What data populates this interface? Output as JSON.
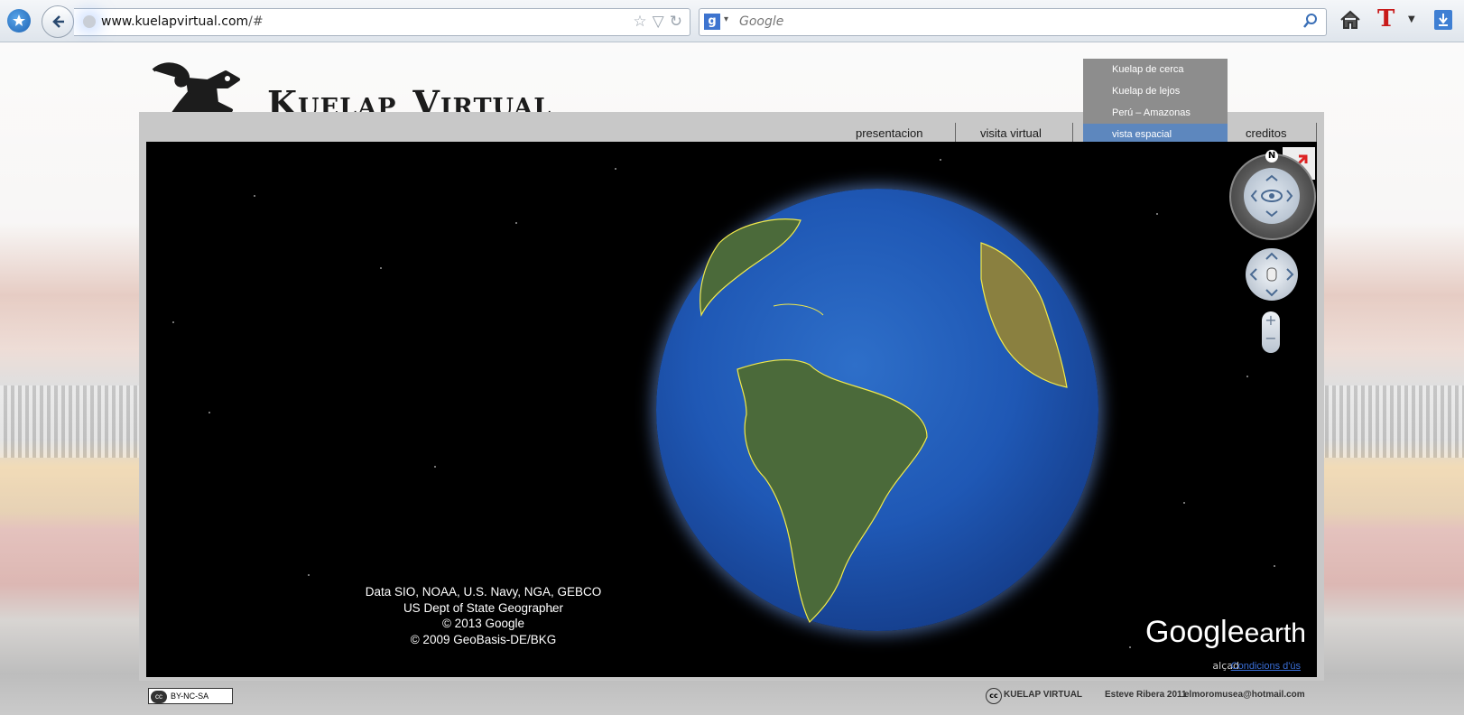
{
  "browser": {
    "url_host": "www.kuelapvirtual.com",
    "url_path": "/#",
    "search_placeholder": "Google"
  },
  "site": {
    "title_word1": "Kuelap",
    "title_word2": "Virtual"
  },
  "nav": {
    "items": [
      "presentacion",
      "visita virtual",
      "creditos"
    ]
  },
  "dropdown": {
    "items": [
      "Kuelap de cerca",
      "Kuelap de lejos",
      "Perú – Amazonas",
      "vista espacial"
    ],
    "active_index": 3
  },
  "earth": {
    "attribution": [
      "Data SIO, NOAA, U.S. Navy, NGA, GEBCO",
      "US Dept of State Geographer",
      "© 2013 Google",
      "© 2009 GeoBasis-DE/BKG"
    ],
    "brand_main": "Google",
    "brand_sub": "earth",
    "terms_prefix": "alçad",
    "terms_link": "Condicions d'ús",
    "compass_label": "N",
    "zoom_in": "+",
    "zoom_out": "−"
  },
  "footer": {
    "cc_license": "BY-NC-SA",
    "cc_mark": "cc",
    "site_name": "KUELAP VIRTUAL",
    "author": "Esteve Ribera 2011",
    "email": "elmoromusea@hotmail.com"
  },
  "colors": {
    "dropdown_bg": "#8d8d8d",
    "dropdown_active": "#5d87be",
    "border_yellow": "#f1e94a"
  }
}
